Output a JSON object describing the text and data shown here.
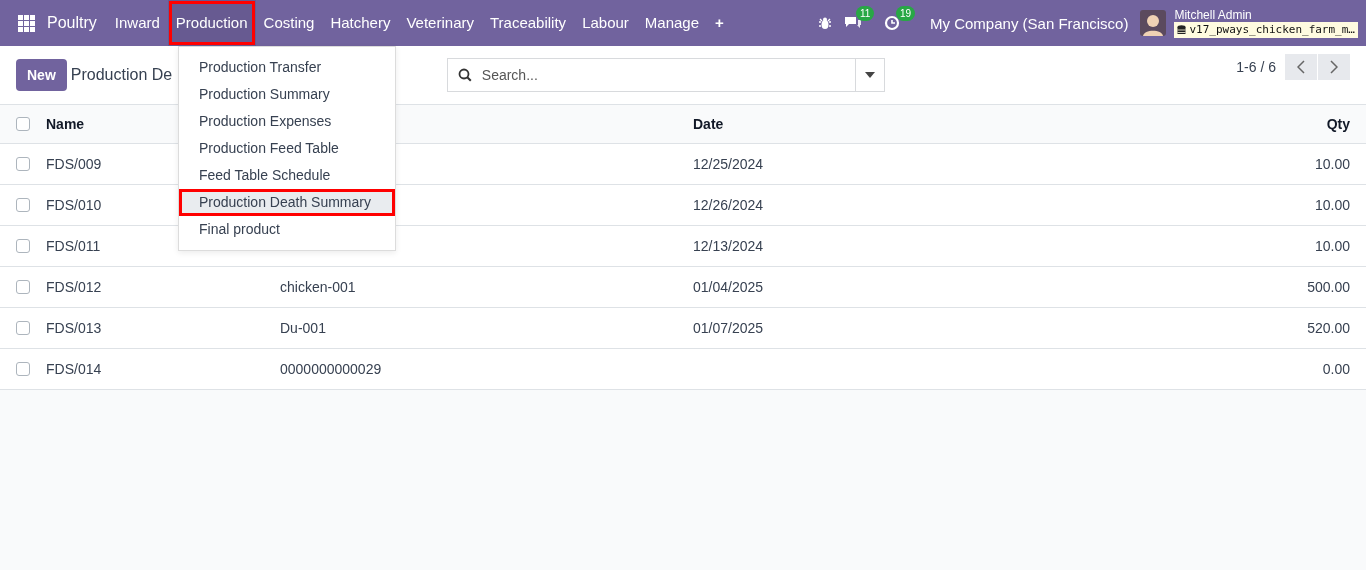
{
  "navbar": {
    "app_name": "Poultry",
    "menu": [
      {
        "label": "Inward",
        "selected": false,
        "highlighted": false
      },
      {
        "label": "Production",
        "selected": true,
        "highlighted": true
      },
      {
        "label": "Costing",
        "selected": false,
        "highlighted": false
      },
      {
        "label": "Hatchery",
        "selected": false,
        "highlighted": false
      },
      {
        "label": "Veterinary",
        "selected": false,
        "highlighted": false
      },
      {
        "label": "Traceability",
        "selected": false,
        "highlighted": false
      },
      {
        "label": "Labour",
        "selected": false,
        "highlighted": false
      },
      {
        "label": "Manage",
        "selected": false,
        "highlighted": false
      },
      {
        "label": "+",
        "selected": false,
        "highlighted": false
      }
    ],
    "messages_count": "11",
    "activities_count": "19",
    "company": "My Company (San Francisco)",
    "user": "Mitchell Admin",
    "database": "v17_pways_chicken_farm_m…"
  },
  "dropdown": [
    {
      "label": "Production Transfer",
      "selected": false,
      "highlighted": false
    },
    {
      "label": "Production Summary",
      "selected": false,
      "highlighted": false
    },
    {
      "label": "Production Expenses",
      "selected": false,
      "highlighted": false
    },
    {
      "label": "Production Feed Table",
      "selected": false,
      "highlighted": false
    },
    {
      "label": "Feed Table Schedule",
      "selected": false,
      "highlighted": false
    },
    {
      "label": "Production Death Summary",
      "selected": true,
      "highlighted": true
    },
    {
      "label": "Final product",
      "selected": false,
      "highlighted": false
    }
  ],
  "control_panel": {
    "new_button": "New",
    "title": "Production De",
    "search": {
      "placeholder": "Search..."
    },
    "pager": "1-6 / 6"
  },
  "table": {
    "select_all_checked": false,
    "columns": [
      {
        "label": "Name"
      },
      {},
      {
        "label": "Date"
      },
      {
        "label": "Qty"
      }
    ],
    "rows": [
      {
        "name": "FDS/009",
        "date": "12/25/2024",
        "qty": "10.00",
        "checked": false
      },
      {
        "name": "FDS/010",
        "date": "12/26/2024",
        "qty": "10.00",
        "checked": false
      },
      {
        "name": "FDS/011",
        "date": "12/13/2024",
        "qty": "10.00",
        "checked": false
      },
      {
        "name": "FDS/012",
        "column_2": "chicken-001",
        "date": "01/04/2025",
        "qty": "500.00",
        "checked": false
      },
      {
        "name": "FDS/013",
        "column_2": "Du-001",
        "date": "01/07/2025",
        "qty": "520.00",
        "checked": false
      },
      {
        "name": "FDS/014",
        "column_2": "0000000000029",
        "qty": "0.00",
        "checked": false
      }
    ]
  }
}
